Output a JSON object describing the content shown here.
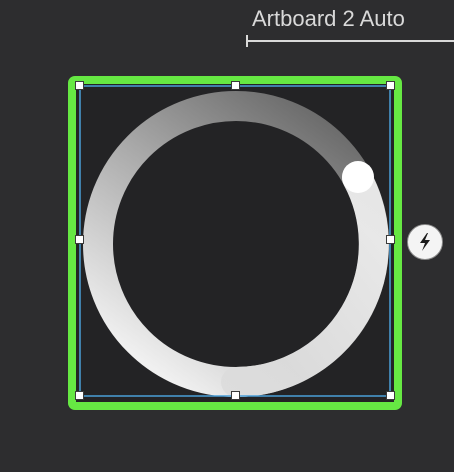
{
  "artboard": {
    "name": "Artboard 2 Auto"
  },
  "colors": {
    "background": "#2d2d2f",
    "selection_frame": "#66e843",
    "bounding_box": "#4a9fd8",
    "artboard_fill": "#232325",
    "ring_light": "#e6e6e6",
    "ring_dark": "#6c6c6c"
  },
  "icons": {
    "bolt": "lightning-bolt-icon"
  }
}
